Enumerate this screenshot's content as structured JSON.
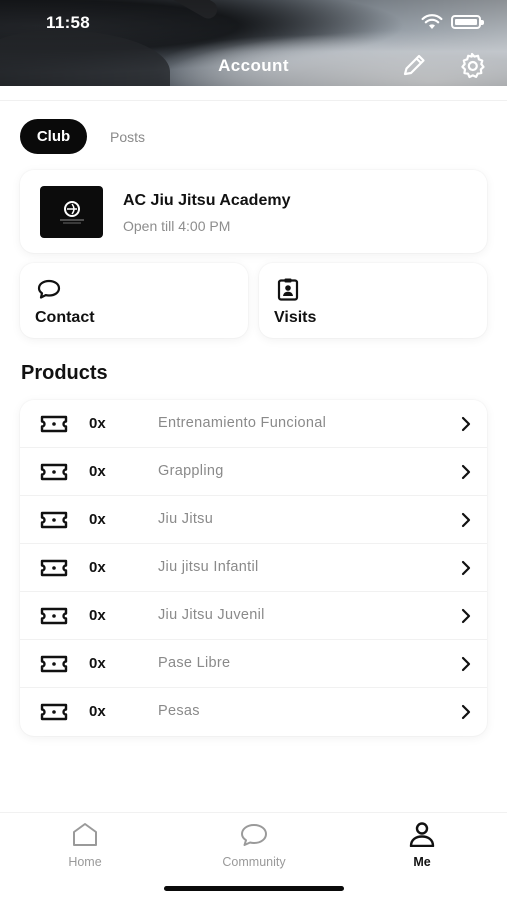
{
  "status_bar": {
    "time": "11:58",
    "wifi_icon": "wifi-icon",
    "battery_icon": "battery-icon"
  },
  "header": {
    "title": "Account",
    "edit_icon": "pencil-icon",
    "settings_icon": "gear-icon"
  },
  "tabs": [
    {
      "label": "Club",
      "selected": true
    },
    {
      "label": "Posts",
      "selected": false
    }
  ],
  "club": {
    "name": "AC Jiu Jitsu Academy",
    "hours": "Open till 4:00 PM"
  },
  "actions": {
    "contact": {
      "label": "Contact",
      "icon": "chat-bubble-icon"
    },
    "visits": {
      "label": "Visits",
      "icon": "id-badge-icon"
    }
  },
  "products": {
    "title": "Products",
    "items": [
      {
        "count": "0x",
        "name": "Entrenamiento Funcional"
      },
      {
        "count": "0x",
        "name": "Grappling"
      },
      {
        "count": "0x",
        "name": "Jiu Jitsu"
      },
      {
        "count": "0x",
        "name": "Jiu jitsu Infantil"
      },
      {
        "count": "0x",
        "name": "Jiu Jitsu Juvenil"
      },
      {
        "count": "0x",
        "name": "Pase Libre"
      },
      {
        "count": "0x",
        "name": "Pesas"
      }
    ]
  },
  "bottom_nav": {
    "items": [
      {
        "label": "Home",
        "icon": "home-icon",
        "active": false
      },
      {
        "label": "Community",
        "icon": "chat-bubble-icon",
        "active": false
      },
      {
        "label": "Me",
        "icon": "person-icon",
        "active": true
      }
    ]
  },
  "colors": {
    "accent": "#0a0a0a",
    "muted_text": "#8a8a8a",
    "background": "#ffffff"
  }
}
